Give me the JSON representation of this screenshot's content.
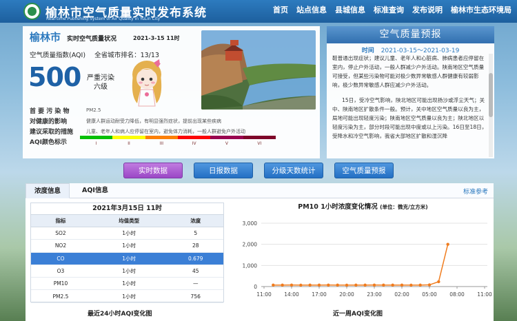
{
  "header": {
    "title": "榆林市空气质量实时发布系统",
    "subtitle": "Real-time Publishing System of Air Quality in YuLin City",
    "nav": [
      "首页",
      "站点信息",
      "县城信息",
      "标准查询",
      "发布说明",
      "榆林市生态环境局"
    ]
  },
  "status": {
    "city": "榆林市",
    "title": "实时空气质量状况",
    "date": "2021-3-15 11时",
    "aqi_label": "空气质量指数(AQI)",
    "rank_label": "全省城市排名：13/13",
    "aqi_value": "500",
    "level_line1": "严重污染",
    "level_line2": "六级",
    "rows": [
      {
        "label": "首 要 污 染 物",
        "value": "PM2.5"
      },
      {
        "label": "对健康的影响",
        "value": "健康人群运动耐受力降低，有明显强烈症状，提前出现某些疾病"
      },
      {
        "label": "建议采取的措施",
        "value": "儿童、老年人和病人应停留在室内，避免体力消耗，一般人群避免户外活动"
      },
      {
        "label": "AQI颜色标示",
        "value": ""
      }
    ],
    "aqi_colors": [
      "#00c000",
      "#ffff00",
      "#ff7e00",
      "#ff0000",
      "#99004c",
      "#7e0023"
    ],
    "aqi_level_labels": [
      "I",
      "II",
      "III",
      "IV",
      "V",
      "VI"
    ]
  },
  "forecast": {
    "title": "空气质量预报",
    "time_label": "时间",
    "time_range": "2021-03-15～2021-03-19",
    "para1": "鞋普通出现症状；建议儿童、老年人和心脏病、肺病患者应停留在室内，停止户外活动，一般人群减少户外活动。陕南地区空气质量可接受，但某些污染物可能对极少数异常敏感人群健康有较弱影响，极少数异常敏感人群应减少户外活动。",
    "para2": "15日，受冷空气影响，陕北地区可能出现扬沙或浮尘天气；关中、陕南地区扩散条件一般。预计，关中地区空气质量以良为主，局地可能出现轻度污染；陕南地区空气质量以良为主；陕北地区以轻度污染为主，部分时段可能出现中度或以上污染。16日至18日，受降水和冷空气影响，我省大部地区扩散和湿沉降"
  },
  "tabs": [
    "实时数据",
    "日报数据",
    "分级天数统计",
    "空气质量预报"
  ],
  "panel": {
    "subtabs": [
      "浓度信息",
      "AQI信息"
    ],
    "std_ref": "标准参考",
    "table_title": "2021年3月15日 11时",
    "table_headers": [
      "指标",
      "均值类型",
      "浓度"
    ],
    "table_rows": [
      [
        "SO2",
        "1小时",
        "5"
      ],
      [
        "NO2",
        "1小时",
        "28"
      ],
      [
        "CO",
        "1小时",
        "0.679"
      ],
      [
        "O3",
        "1小时",
        "45"
      ],
      [
        "PM10",
        "1小时",
        "—"
      ],
      [
        "PM2.5",
        "1小时",
        "756"
      ]
    ],
    "chart_title": "PM10  1小时浓度变化情况",
    "chart_unit": "(单位：微克/立方米)",
    "footer_left": "最近24小时AQI变化图",
    "footer_right": "近一周AQI变化图"
  },
  "chart_data": {
    "type": "line",
    "title": "PM10 1小时浓度变化情况",
    "unit": "单位：微克/立方米",
    "x_ticks": [
      "11:00",
      "14:00",
      "17:00",
      "20:00",
      "23:00",
      "02:00",
      "05:00",
      "08:00",
      "11:00"
    ],
    "y_ticks": [
      "0",
      "1,000",
      "2,000",
      "3,000"
    ],
    "ylim": [
      0,
      3000
    ],
    "x": [
      "12:00",
      "13:00",
      "14:00",
      "15:00",
      "16:00",
      "17:00",
      "18:00",
      "19:00",
      "20:00",
      "21:00",
      "22:00",
      "23:00",
      "00:00",
      "01:00",
      "02:00",
      "03:00",
      "04:00",
      "05:00",
      "06:00",
      "07:00"
    ],
    "series": [
      {
        "values": [
          70,
          70,
          72,
          68,
          70,
          70,
          72,
          70,
          68,
          70,
          70,
          72,
          70,
          70,
          70,
          68,
          70,
          80,
          230,
          2000
        ],
        "color": "#f07c1e"
      }
    ],
    "grid": true,
    "legend": "none"
  }
}
